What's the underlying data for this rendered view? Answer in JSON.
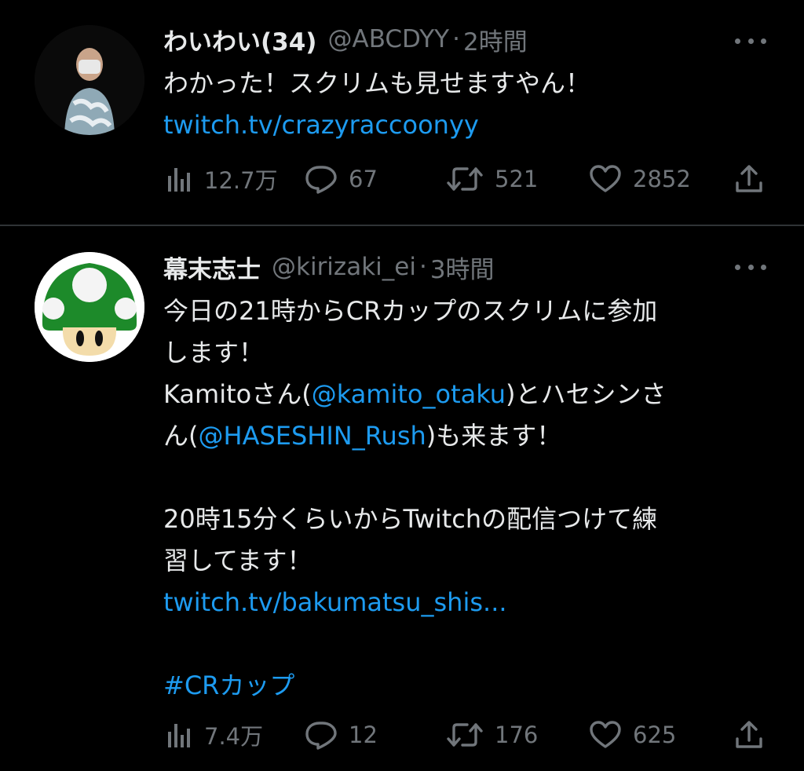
{
  "tweets": [
    {
      "name": "わいわい(34)",
      "handle": "@ABCDYY",
      "separator": "·",
      "time": "2時間",
      "lines": [
        {
          "text": "わかった！スクリムも見せますやん！"
        }
      ],
      "link": "twitch.tv/crazyraccoonyy",
      "stats": {
        "views": "12.7万",
        "replies": "67",
        "retweets": "521",
        "likes": "2852"
      }
    },
    {
      "name": "幕末志士",
      "handle": "@kirizaki_ei",
      "separator": "·",
      "time": "3時間",
      "line1": "今日の21時からCRカップのスクリムに参加",
      "line2": "します！",
      "line3_a": "Kamitoさん(",
      "line3_mention": "@kamito_otaku",
      "line3_b": ")とハセシンさ",
      "line4_a": "ん(",
      "line4_mention": "@HASESHIN_Rush",
      "line4_b": ")も来ます！",
      "line5": "20時15分くらいからTwitchの配信つけて練",
      "line6": "習してます！",
      "link": "twitch.tv/bakumatsu_shis...",
      "hashtag": "#CRカップ",
      "stats": {
        "views": "7.4万",
        "replies": "12",
        "retweets": "176",
        "likes": "625"
      }
    }
  ],
  "colors": {
    "background": "#000000",
    "text": "#e7e9ea",
    "muted": "#71767b",
    "link": "#1d9bf0",
    "divider": "#2f3336"
  },
  "icons": [
    "views-icon",
    "reply-icon",
    "retweet-icon",
    "like-icon",
    "share-icon",
    "more-icon"
  ]
}
